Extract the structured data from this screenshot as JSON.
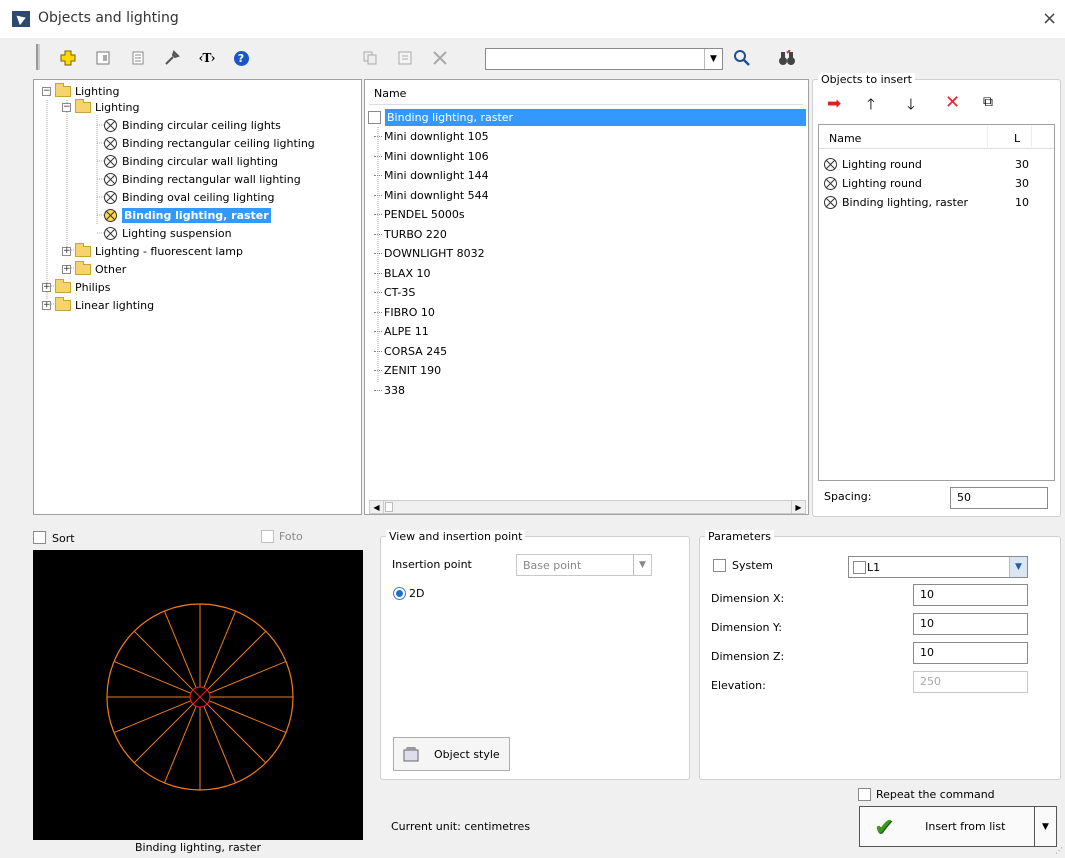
{
  "window": {
    "title": "Objects and lighting",
    "close_glyph": "×"
  },
  "toolbar": {
    "search_value": "",
    "icons": [
      "add-icon",
      "card-icon",
      "list-icon",
      "tools-icon",
      "text-tag-icon",
      "help-icon",
      "copy-icon",
      "table-icon",
      "delete-icon",
      "search-icon",
      "binoculars-icon"
    ],
    "tag_glyph": "‹T›",
    "help_glyph": "?"
  },
  "tree": {
    "items": [
      {
        "label": "Lighting",
        "type": "folder",
        "expander": "−"
      },
      {
        "label": "Lighting",
        "type": "folder",
        "expander": "−"
      },
      {
        "label": "Binding circular ceiling lights",
        "type": "lamp"
      },
      {
        "label": "Binding rectangular ceiling lighting",
        "type": "lamp"
      },
      {
        "label": "Binding circular wall lighting",
        "type": "lamp"
      },
      {
        "label": "Binding rectangular wall lighting",
        "type": "lamp"
      },
      {
        "label": "Binding oval ceiling lighting",
        "type": "lamp"
      },
      {
        "label": "Binding lighting, raster",
        "type": "lamp",
        "selected": true
      },
      {
        "label": "Lighting suspension",
        "type": "lamp"
      },
      {
        "label": "Lighting - fluorescent lamp",
        "type": "folder",
        "expander": "+"
      },
      {
        "label": "Other",
        "type": "folder",
        "expander": "+"
      },
      {
        "label": "Philips",
        "type": "folder",
        "expander": "+"
      },
      {
        "label": "Linear lighting",
        "type": "folder",
        "expander": "+"
      }
    ]
  },
  "list": {
    "header": "Name",
    "items": [
      "Binding lighting, raster",
      "Mini downlight 105",
      "Mini downlight 106",
      "Mini downlight 144",
      "Mini downlight 544",
      "PENDEL 5000s",
      "TURBO 220",
      "DOWNLIGHT 8032",
      "BLAX 10",
      "CT-3S",
      "FIBRO 10",
      "ALPE 11",
      "CORSA 245",
      "ZENIT 190",
      "338"
    ],
    "scroll_left": "◀",
    "scroll_right": "▶"
  },
  "objects_to_insert": {
    "title": "Objects to insert",
    "col_name": "Name",
    "col_l": "L",
    "rows": [
      {
        "name": "Lighting round",
        "l": "30"
      },
      {
        "name": "Lighting round",
        "l": "30"
      },
      {
        "name": "Binding lighting, raster",
        "l": "10"
      }
    ],
    "spacing_label": "Spacing:",
    "spacing_value": "50",
    "action_glyphs": {
      "arrow_right": "➡",
      "up": "🡑",
      "down": "🡓",
      "delete": "✕",
      "copy": "⧉"
    },
    "colors": {
      "arrow_right": "#e02020",
      "delete": "#d03030"
    }
  },
  "preview": {
    "sort_label": "Sort",
    "foto_label": "Foto",
    "caption": "Binding lighting, raster",
    "spokes": 16,
    "colors": {
      "bg": "#000000",
      "stroke": "#f07c1e",
      "center": "#e02020"
    }
  },
  "view": {
    "title": "View and insertion point",
    "insertion_label": "Insertion point",
    "insertion_value": "Base point",
    "mode_2d": "2D",
    "object_style_label": "Object style"
  },
  "params": {
    "title": "Parameters",
    "system_label": "System",
    "system_value": "L1",
    "dim_x_label": "Dimension X:",
    "dim_x_value": "10",
    "dim_y_label": "Dimension Y:",
    "dim_y_value": "10",
    "dim_z_label": "Dimension Z:",
    "dim_z_value": "10",
    "elevation_label": "Elevation:",
    "elevation_value": "250"
  },
  "footer": {
    "current_unit": "Current unit: centimetres",
    "repeat_label": "Repeat the command",
    "insert_label": "Insert from list",
    "insert_glyph": "✔",
    "dropdown_glyph": "▼"
  }
}
